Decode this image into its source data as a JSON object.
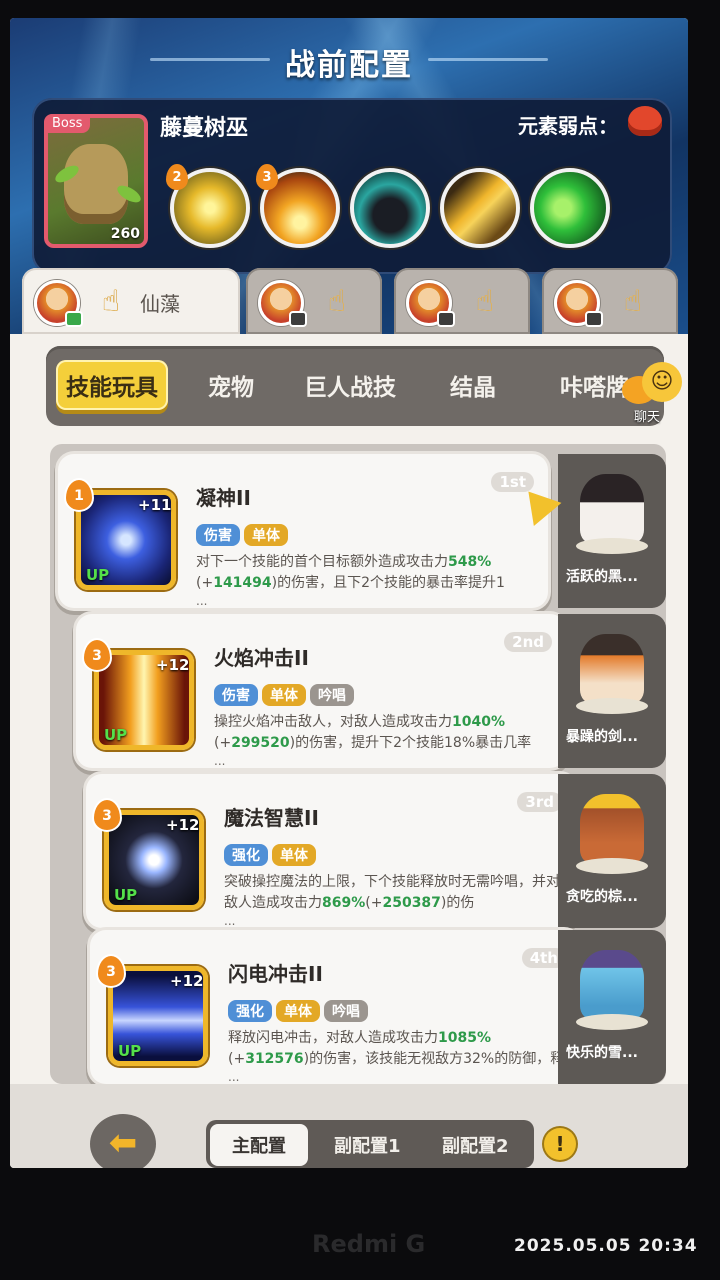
{
  "header": {
    "title": "战前配置"
  },
  "boss": {
    "tag": "Boss",
    "name": "藤蔓树巫",
    "level": "260",
    "weakness_label": "元素弱点：",
    "weakness_icon": "fire-element-icon",
    "skills": [
      {
        "badge": "2",
        "icon": "sunburst-skill-icon"
      },
      {
        "badge": "3",
        "icon": "flame-skill-icon"
      },
      {
        "badge": "",
        "icon": "shadow-creature-skill-icon"
      },
      {
        "badge": "",
        "icon": "golden-blade-skill-icon"
      },
      {
        "badge": "",
        "icon": "poison-bubbles-skill-icon"
      }
    ]
  },
  "character_tabs": [
    {
      "name": "仙藻",
      "active": true
    },
    {
      "name": "",
      "active": false
    },
    {
      "name": "",
      "active": false
    },
    {
      "name": "",
      "active": false
    }
  ],
  "categories": {
    "skill_toys": "技能玩具",
    "pets": "宠物",
    "giant_skills": "巨人战技",
    "crystals": "结晶",
    "cards": "咔嗒牌",
    "chat": "聊天"
  },
  "skills": [
    {
      "level": "1",
      "plus": "+11",
      "up": "UP",
      "name": "凝神II",
      "rank": "1st",
      "tags": [
        "伤害",
        "单体"
      ],
      "desc_pre": "对下一个技能的首个目标额外造成攻击力",
      "desc_hl1": "548%",
      "desc_mid": "(+",
      "desc_hl2": "141494",
      "desc_post": ")的伤害，且下2个技能的暴击率提升1",
      "more": "...",
      "pet_name": "活跃的黑..."
    },
    {
      "level": "3",
      "plus": "+12",
      "up": "UP",
      "name": "火焰冲击II",
      "rank": "2nd",
      "tags": [
        "伤害",
        "单体",
        "吟唱"
      ],
      "desc_pre": "操控火焰冲击敌人，对敌人造成攻击力",
      "desc_hl1": "1040%",
      "desc_mid": "(+",
      "desc_hl2": "299520",
      "desc_post": ")的伤害，提升下2个技能18%暴击几率",
      "more": "...",
      "pet_name": "暴躁的剑..."
    },
    {
      "level": "3",
      "plus": "+12",
      "up": "UP",
      "name": "魔法智慧II",
      "rank": "3rd",
      "tags": [
        "强化",
        "单体"
      ],
      "desc_pre": "突破操控魔法的上限，下个技能释放时无需吟唱，并对敌人造成攻击力",
      "desc_hl1": "869%",
      "desc_mid": "(+",
      "desc_hl2": "250387",
      "desc_post": ")的伤",
      "more": "...",
      "pet_name": "贪吃的棕..."
    },
    {
      "level": "3",
      "plus": "+12",
      "up": "UP",
      "name": "闪电冲击II",
      "rank": "4th",
      "tags": [
        "强化",
        "单体",
        "吟唱"
      ],
      "desc_pre": "释放闪电冲击，对敌人造成攻击力",
      "desc_hl1": "1085%",
      "desc_mid": "(+",
      "desc_hl2": "312576",
      "desc_post": ")的伤害，该技能无视敌方32%的防御，释",
      "more": "...",
      "pet_name": "快乐的雪..."
    }
  ],
  "config": {
    "main": "主配置",
    "sub1": "副配置1",
    "sub2": "副配置2",
    "info": "!"
  },
  "watermark": {
    "brand": "Redmi G",
    "timestamp": "2025.05.05  20:34"
  }
}
